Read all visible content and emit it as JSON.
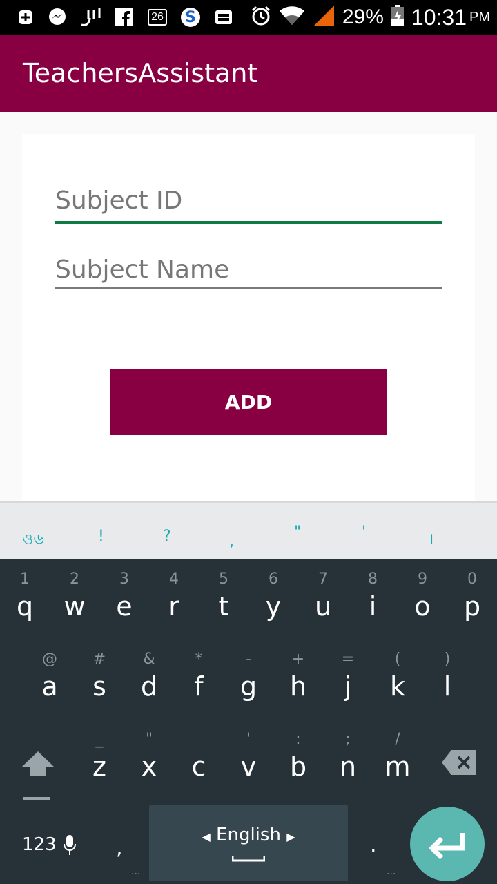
{
  "status_bar": {
    "notification_count": "26",
    "battery_percent": "29%",
    "time": "10:31",
    "ampm": "PM"
  },
  "app_bar": {
    "title": "TeachersAssistant"
  },
  "form": {
    "subject_id": {
      "value": "",
      "placeholder": "Subject ID"
    },
    "subject_name": {
      "value": "",
      "placeholder": "Subject Name"
    },
    "add_label": "ADD"
  },
  "keyboard": {
    "suggestions": [
      "ওড",
      "!",
      "?",
      ",",
      "\"",
      "'",
      "।"
    ],
    "row1": [
      {
        "hint": "1",
        "key": "q"
      },
      {
        "hint": "2",
        "key": "w"
      },
      {
        "hint": "3",
        "key": "e"
      },
      {
        "hint": "4",
        "key": "r"
      },
      {
        "hint": "5",
        "key": "t"
      },
      {
        "hint": "6",
        "key": "y"
      },
      {
        "hint": "7",
        "key": "u"
      },
      {
        "hint": "8",
        "key": "i"
      },
      {
        "hint": "9",
        "key": "o"
      },
      {
        "hint": "0",
        "key": "p"
      }
    ],
    "row2": [
      {
        "hint": "@",
        "key": "a"
      },
      {
        "hint": "#",
        "key": "s"
      },
      {
        "hint": "&",
        "key": "d"
      },
      {
        "hint": "*",
        "key": "f"
      },
      {
        "hint": "-",
        "key": "g"
      },
      {
        "hint": "+",
        "key": "h"
      },
      {
        "hint": "=",
        "key": "j"
      },
      {
        "hint": "(",
        "key": "k"
      },
      {
        "hint": ")",
        "key": "l"
      }
    ],
    "row3": [
      {
        "hint": "_",
        "key": "z"
      },
      {
        "hint": "\"",
        "key": "x"
      },
      {
        "hint": "",
        "key": "c"
      },
      {
        "hint": "'",
        "key": "v"
      },
      {
        "hint": ":",
        "key": "b"
      },
      {
        "hint": ";",
        "key": "n"
      },
      {
        "hint": "/",
        "key": "m"
      }
    ],
    "numbers_label": "123",
    "comma": ",",
    "language": "English",
    "period": ".",
    "more_dots": "..."
  },
  "colors": {
    "primary": "#880042",
    "accent": "#0f7a44",
    "keyboard_bg": "#263238",
    "enter_key": "#5bb8b0"
  }
}
